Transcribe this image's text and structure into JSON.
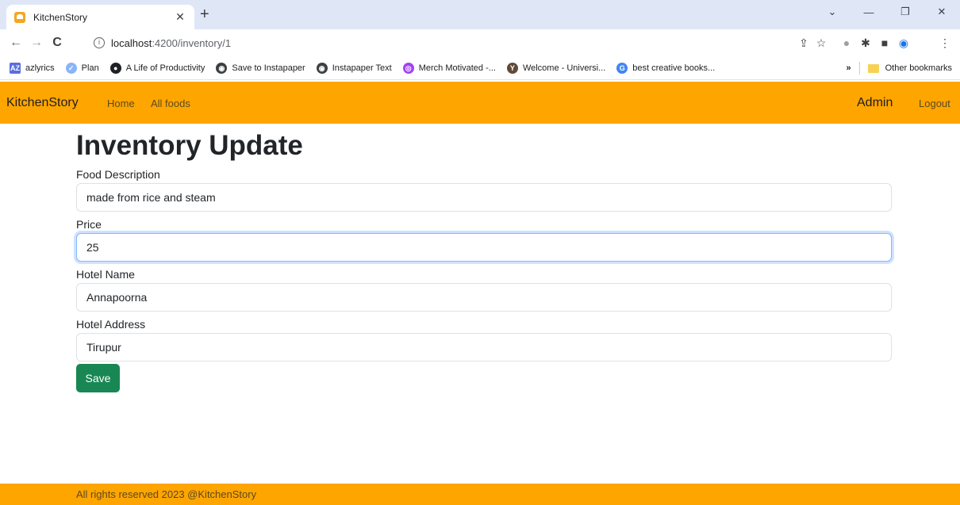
{
  "browser": {
    "tab_title": "KitchenStory",
    "url_host": "localhost",
    "url_path": ":4200/inventory/1",
    "bookmarks": [
      {
        "label": "azlyrics",
        "color": "#5b6ee1",
        "glyph": "AZ"
      },
      {
        "label": "Plan",
        "color": "#8ab4f8",
        "glyph": "✓"
      },
      {
        "label": "A Life of Productivity",
        "color": "#202124",
        "glyph": "●"
      },
      {
        "label": "Save to Instapaper",
        "color": "#3c4043",
        "glyph": "◉"
      },
      {
        "label": "Instapaper Text",
        "color": "#3c4043",
        "glyph": "◉"
      },
      {
        "label": "Merch Motivated -...",
        "color": "#a142f4",
        "glyph": "◎"
      },
      {
        "label": "Welcome - Universi...",
        "color": "#5f4a3a",
        "glyph": "Y"
      },
      {
        "label": "best creative books...",
        "color": "#4285f4",
        "glyph": "G"
      }
    ],
    "overflow_label": "»",
    "other_bookmarks": "Other bookmarks"
  },
  "navbar": {
    "brand": "KitchenStory",
    "links": [
      "Home",
      "All foods"
    ],
    "user": "Admin",
    "logout": "Logout",
    "color": "#ffa500"
  },
  "form": {
    "title": "Inventory Update",
    "fields": [
      {
        "label": "Food Description",
        "value": "made from rice and steam"
      },
      {
        "label": "Price",
        "value": "25"
      },
      {
        "label": "Hotel Name",
        "value": "Annapoorna"
      },
      {
        "label": "Hotel Address",
        "value": "Tirupur"
      }
    ],
    "save_label": "Save",
    "save_color": "#198754"
  },
  "footer": {
    "text": "All rights reserved 2023 @KitchenStory"
  }
}
